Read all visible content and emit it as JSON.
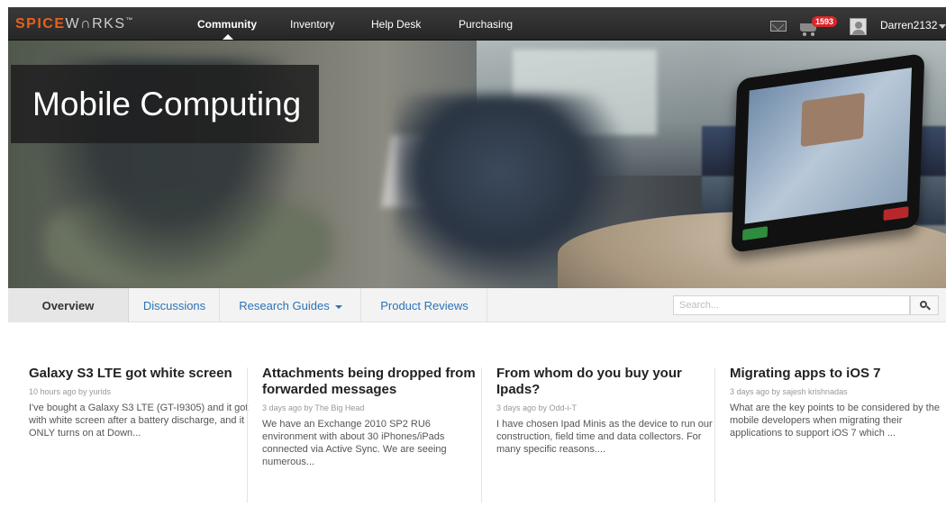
{
  "header": {
    "logo_spice": "SPICE",
    "logo_works": "W∩RKS",
    "logo_tm": "™",
    "nav": [
      "Community",
      "Inventory",
      "Help Desk",
      "Purchasing"
    ],
    "cart_count": "1593",
    "username": "Darren2132"
  },
  "hero": {
    "title": "Mobile Computing"
  },
  "subnav": {
    "tabs": [
      "Overview",
      "Discussions",
      "Research Guides",
      "Product Reviews"
    ],
    "search_placeholder": "Search..."
  },
  "articles": [
    {
      "title": "Galaxy S3 LTE got white screen",
      "meta": "10 hours ago by yurids",
      "body": "I've bought a Galaxy S3 LTE (GT-I9305) and it got with white screen after a battery discharge, and it ONLY turns on at Down..."
    },
    {
      "title": "Attachments being dropped from forwarded messages",
      "meta": "3 days ago by The Big Head",
      "body": "We have an Exchange 2010 SP2 RU6 environment with about 30 iPhones/iPads connected via Active Sync.  We are seeing numerous..."
    },
    {
      "title": "From whom do you buy your Ipads?",
      "meta": "3 days ago by Odd-i-T",
      "body": "I have chosen Ipad Minis as the device to run our construction, field time and data collectors.  For many specific reasons...."
    },
    {
      "title": "Migrating apps to iOS 7",
      "meta": "3 days ago by sajesh krishnadas",
      "body": "What are the key points to be considered by the mobile developers when migrating their applications to support iOS 7 which ..."
    }
  ],
  "colors": {
    "topbar": "#2d2d2d",
    "logo_orange": "#e8601c",
    "link_blue": "#2b73b8",
    "badge_red": "#d8262a"
  }
}
